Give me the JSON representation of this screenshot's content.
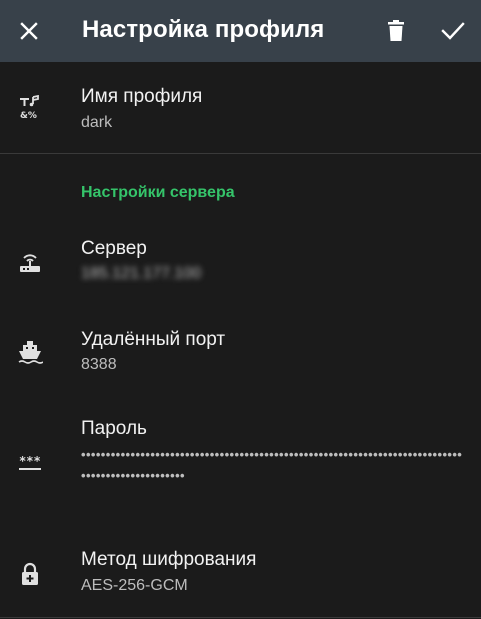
{
  "appbar": {
    "title": "Настройка профиля",
    "close_icon": "close-icon",
    "delete_icon": "trash-icon",
    "confirm_icon": "check-icon"
  },
  "profile": {
    "name_label": "Имя профиля",
    "name_value": "dark"
  },
  "server_section": {
    "header": "Настройки сервера",
    "server_label": "Сервер",
    "server_value": "185.121.177.100",
    "port_label": "Удалённый порт",
    "port_value": "8388",
    "password_label": "Пароль",
    "password_value": "••••••••••••••••••••••••••••••••••••••••••••••••••••••••••••••••••••••••••••••••••••••••••••••••••",
    "method_label": "Метод шифрования",
    "method_value": "AES-256-GCM"
  },
  "colors": {
    "appbar_bg": "#38414a",
    "background": "#1b1b1b",
    "accent": "#35c46a"
  }
}
